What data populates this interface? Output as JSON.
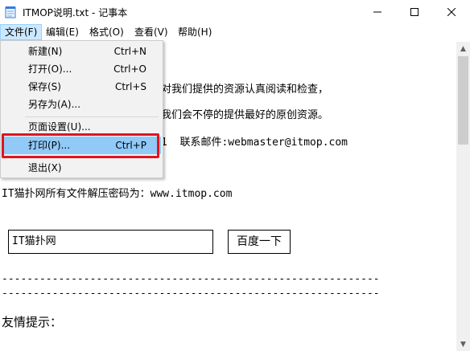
{
  "window": {
    "title": "ITMOP说明.txt - 记事本",
    "buttons": {
      "minimize": "—",
      "maximize": "☐",
      "close": "✕"
    }
  },
  "menubar": {
    "items": [
      {
        "label": "文件(F)"
      },
      {
        "label": "编辑(E)"
      },
      {
        "label": "格式(O)"
      },
      {
        "label": "查看(V)"
      },
      {
        "label": "帮助(H)"
      }
    ]
  },
  "file_menu": {
    "items": [
      {
        "label": "新建(N)",
        "shortcut": "Ctrl+N"
      },
      {
        "label": "打开(O)...",
        "shortcut": "Ctrl+O"
      },
      {
        "label": "保存(S)",
        "shortcut": "Ctrl+S"
      },
      {
        "label": "另存为(A)...",
        "shortcut": ""
      },
      {
        "label": "页面设置(U)...",
        "shortcut": ""
      },
      {
        "label": "打印(P)...",
        "shortcut": "Ctrl+P"
      },
      {
        "label": "退出(X)",
        "shortcut": ""
      }
    ],
    "highlighted": "打印(P)..."
  },
  "editor": {
    "lines": [
      "对我们提供的资源认真阅读和检查，",
      "我们会不停的提供最好的原创资源。",
      "1  联系邮件:webmaster@itmop.com",
      "IT猫扑网所有文件解压密码为：www.itmop.com",
      "------------------------------------------------------------",
      "------------------------------------------------------------",
      "友情提示："
    ],
    "search_box_text": "IT猫扑网",
    "search_button_text": "百度一下"
  },
  "colors": {
    "menu_highlight": "#91c9f7",
    "annotation_frame": "#e0141e",
    "active_menu": "#cce8ff"
  }
}
